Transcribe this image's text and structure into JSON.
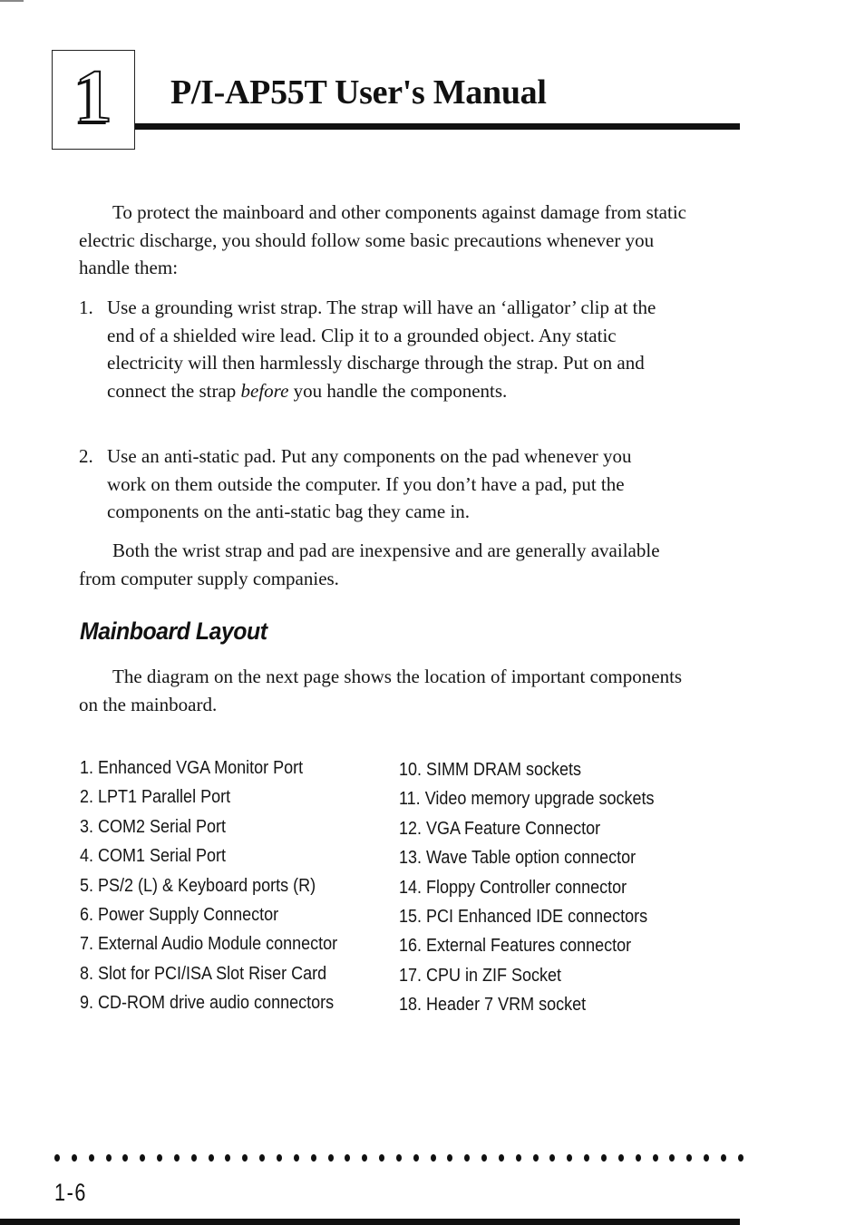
{
  "header": {
    "chapter_number": "1",
    "title": "P/I-AP55T User's Manual"
  },
  "intro_paragraph": "To protect the mainboard and other components against damage from static electric discharge, you should follow some basic precautions whenever you handle them:",
  "precautions": [
    {
      "number": "1.",
      "text_before_em": "Use a grounding wrist strap. The strap will have an ‘alligator’ clip at the end of a shielded wire lead. Clip it to a grounded object. Any static electricity will then harmlessly discharge through the strap. Put on and connect the strap ",
      "emphasis": "before",
      "text_after_em": " you handle the components."
    },
    {
      "number": "2.",
      "text": "Use an anti-static pad. Put any components on the pad whenever you work on them outside the computer. If you don’t have a pad, put the components on the anti-static bag they came in."
    }
  ],
  "closing_paragraph": "Both the wrist strap and pad are inexpensive and are generally available from computer supply companies.",
  "section": {
    "heading": "Mainboard Layout",
    "paragraph": "The diagram on the next page shows the location of important components on the mainboard."
  },
  "components_left": [
    "1. Enhanced VGA Monitor Port",
    "2. LPT1 Parallel Port",
    "3. COM2 Serial Port",
    "4. COM1 Serial Port",
    "5. PS/2 (L) & Keyboard ports (R)",
    "6. Power Supply Connector",
    "7. External Audio Module connector",
    "8. Slot for PCI/ISA Slot Riser Card",
    "9. CD-ROM drive audio connectors"
  ],
  "components_right": [
    "10. SIMM DRAM sockets",
    "11. Video memory upgrade sockets",
    "12. VGA Feature Connector",
    "13. Wave Table option connector",
    "14. Floppy Controller connector",
    "15. PCI Enhanced IDE connectors",
    "16. External Features connector",
    "17. CPU in ZIF Socket",
    "18. Header 7 VRM socket"
  ],
  "footer": {
    "page_number": "1-6"
  }
}
